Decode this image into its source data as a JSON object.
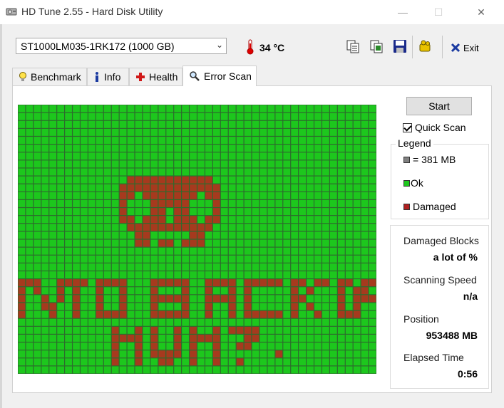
{
  "window": {
    "title": "HD Tune 2.55 - Hard Disk Utility",
    "controls": [
      "—",
      "☐",
      "✕"
    ]
  },
  "toolbar": {
    "drive": "ST1000LM035-1RK172 (1000 GB)",
    "temperature": "34 °C",
    "exit_label": "Exit"
  },
  "tabs": [
    {
      "label": "Benchmark",
      "icon": "lightbulb-icon"
    },
    {
      "label": "Info",
      "icon": "info-icon"
    },
    {
      "label": "Health",
      "icon": "health-cross-icon"
    },
    {
      "label": "Error Scan",
      "icon": "magnifier-icon",
      "active": true
    }
  ],
  "scan": {
    "start_label": "Start",
    "quick_scan_label": "Quick Scan",
    "quick_scan_checked": true,
    "legend_title": "Legend",
    "legend": [
      {
        "label": "= 381 MB",
        "color": "#808080"
      },
      {
        "label": "Ok",
        "color": "#1dc71d"
      },
      {
        "label": "Damaged",
        "color": "#b02020"
      }
    ],
    "stats": [
      {
        "label": "Damaged Blocks",
        "value": "a lot of %"
      },
      {
        "label": "Scanning Speed",
        "value": "n/a"
      },
      {
        "label": "Position",
        "value": "953488 MB"
      },
      {
        "label": "Elapsed Time",
        "value": "0:56"
      }
    ]
  },
  "grid": {
    "cols": 46,
    "rows": 34,
    "ok_color": "#1dc71d",
    "damaged_color": "#a63a1e",
    "line_color": "#2d6b2d",
    "pattern": [
      "..............................................",
      "..............................................",
      "..............................................",
      "..............................................",
      "..............................................",
      "..............................................",
      "..............................................",
      "..............................................",
      "..............................................",
      "..............XXXXXXXXXXX.....................",
      ".............XXXXXXXXXXXXX....................",
      ".............XX.XXXXXXX.XX....................",
      ".............X...XXXXX...X....................",
      ".............X...XX.XX...X....................",
      ".............XX.XXX.XXX.XX....................",
      "..............XXXXXXXXXXX.....................",
      "...............XX.....XX......................",
      "...............XX.XX.XXX......................",
      "..............................................",
      "..............................................",
      "..............................................",
      "..............................................",
      "XXX..XXXX.XXXX...XXXXX..XXXX.XXXXX.XX.XX.XX.XX",
      "X.X..X.X..X..X...X...X..X..X.X.....X.X...X.XX.",
      "X..X.X.X..X..X...XXXXX..XXXX.X.....XX....X.XXX",
      "X..XX..X..X..X...X...X..X..X.X.....X.X...X.X..",
      "X...X..X..XXXX...XXXXX..X..X.XXXXX.X..X..XXX..",
      "..............................................",
      "............X..X.X..X.X..X.XXXX...............",
      "............XXXX.X..X.XXXX...XX...............",
      "............X..X.X..X.X..X..XX................",
      "............X..X.XXXX.X..X.......X............",
      "............X..X..XX..X..X..X.................",
      ".............................................."
    ]
  }
}
